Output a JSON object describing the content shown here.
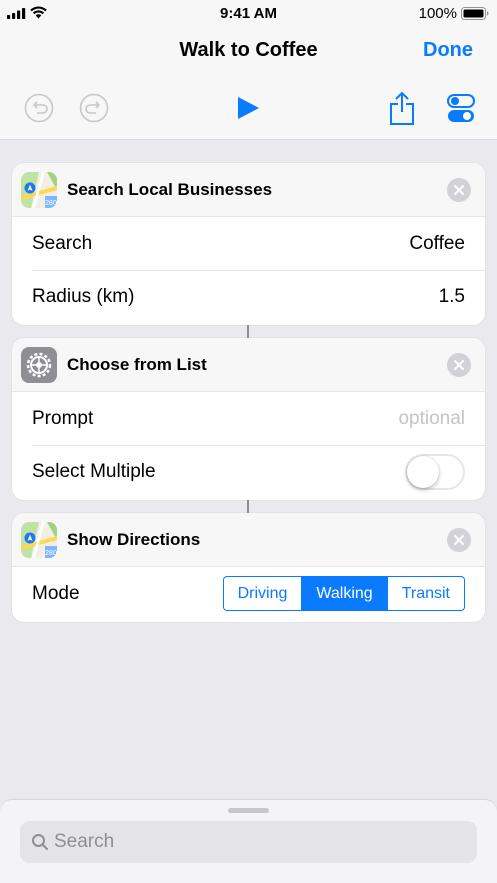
{
  "status": {
    "time": "9:41 AM",
    "battery": "100%"
  },
  "nav": {
    "title": "Walk to Coffee",
    "done": "Done"
  },
  "actions": [
    {
      "title": "Search Local Businesses",
      "icon": "maps-icon",
      "rows": [
        {
          "label": "Search",
          "value": "Coffee"
        },
        {
          "label": "Radius (km)",
          "value": "1.5"
        }
      ]
    },
    {
      "title": "Choose from List",
      "icon": "settings-icon",
      "rows": [
        {
          "label": "Prompt",
          "placeholder": "optional"
        },
        {
          "label": "Select Multiple",
          "toggle": false
        }
      ]
    },
    {
      "title": "Show Directions",
      "icon": "maps-icon",
      "rows": [
        {
          "label": "Mode",
          "options": [
            "Driving",
            "Walking",
            "Transit"
          ],
          "selected": "Walking"
        }
      ]
    }
  ],
  "search": {
    "placeholder": "Search"
  },
  "colors": {
    "accent": "#0a7aff",
    "background": "#e9e9ee"
  }
}
